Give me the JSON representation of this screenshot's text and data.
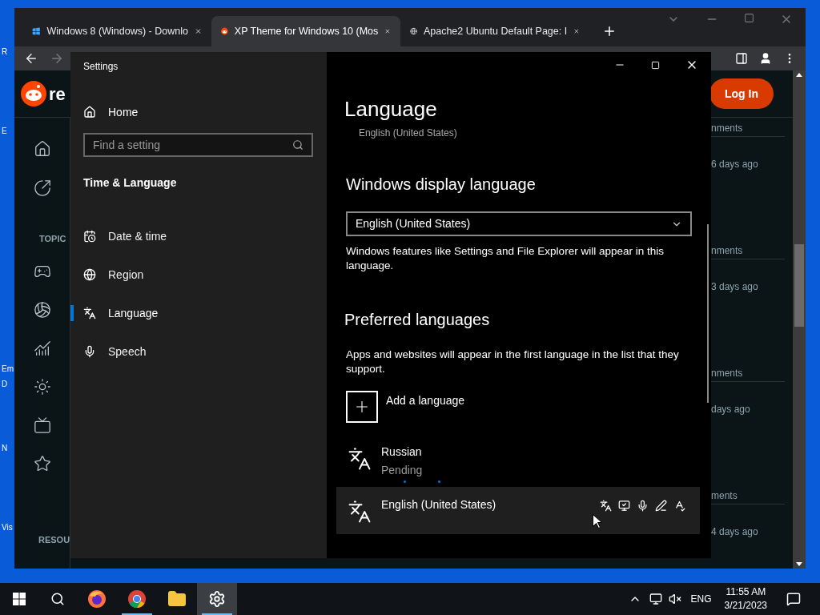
{
  "desktop_icons": [
    {
      "label": "R"
    },
    {
      "label": "E"
    },
    {
      "label": "Em"
    },
    {
      "label": "D"
    },
    {
      "label": "N"
    },
    {
      "label": "Vis"
    }
  ],
  "browser": {
    "tabs": [
      {
        "title": "Windows 8 (Windows) - Downlo",
        "kind": "windows",
        "selected": false
      },
      {
        "title": "XP Theme for Windows 10 (Mos",
        "kind": "reddit",
        "selected": true
      },
      {
        "title": "Apache2 Ubuntu Default Page: I",
        "kind": "globe",
        "selected": false
      }
    ],
    "page": {
      "logo_text": "re",
      "login": "Log In",
      "topics_heading": "TOPIC",
      "resources_heading": "RESOU",
      "feed": [
        {
          "kind": "comments",
          "text": "nments"
        },
        {
          "kind": "age",
          "text": "6 days ago"
        },
        {
          "kind": "comments",
          "text": "nments"
        },
        {
          "kind": "age",
          "text": "3 days ago"
        },
        {
          "kind": "comments",
          "text": "nments"
        },
        {
          "kind": "age",
          "text": "days ago"
        },
        {
          "kind": "comments",
          "text": "ments"
        },
        {
          "kind": "age",
          "text": "4 days ago"
        }
      ]
    }
  },
  "settings": {
    "title": "Settings",
    "home": "Home",
    "search": {
      "placeholder": "Find a setting"
    },
    "section": "Time & Language",
    "nav": [
      {
        "label": "Date & time",
        "kind": "date",
        "selected": false
      },
      {
        "label": "Region",
        "kind": "region",
        "selected": false
      },
      {
        "label": "Language",
        "kind": "language",
        "selected": true
      },
      {
        "label": "Speech",
        "kind": "speech",
        "selected": false
      }
    ],
    "heading": "Language",
    "subtitle": "English (United States)",
    "display_language": {
      "heading": "Windows display language",
      "value": "English (United States)",
      "note": "Windows features like Settings and File Explorer will appear in this language."
    },
    "preferred": {
      "heading": "Preferred languages",
      "note": "Apps and websites will appear in the first language in the list that they support.",
      "add": "Add a language",
      "languages": [
        {
          "name": "Russian",
          "status": "Pending",
          "selected": false
        },
        {
          "name": "English (United States)",
          "selected": true
        }
      ]
    }
  },
  "taskbar": {
    "apps": [
      {
        "kind": "firefox",
        "running": false,
        "selected": false
      },
      {
        "kind": "chrome",
        "running": true,
        "selected": false
      },
      {
        "kind": "explorer",
        "running": false,
        "selected": false
      },
      {
        "kind": "settings",
        "running": true,
        "selected": true
      }
    ],
    "language": "ENG",
    "time": "11:55 AM",
    "date": "3/21/2023"
  }
}
